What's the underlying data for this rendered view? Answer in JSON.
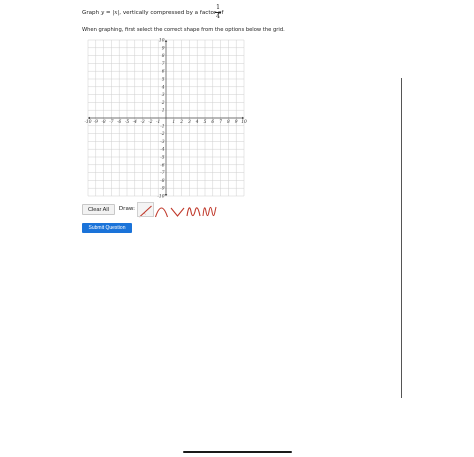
{
  "question": {
    "prefix": "Graph ",
    "equation": "y = |x|",
    "suffix": ", vertically compressed by a factor of ",
    "fraction": {
      "numerator": "1",
      "denominator": "4"
    }
  },
  "instructions": "When graphing, first select the correct shape from the options below the grid.",
  "grid": {
    "x_ticks": [
      "-10",
      "-9",
      "-8",
      "-7",
      "-6",
      "-5",
      "-4",
      "-3",
      "-2",
      "-1",
      "1",
      "2",
      "3",
      "4",
      "5",
      "6",
      "7",
      "8",
      "9",
      "10"
    ],
    "y_ticks": [
      "10",
      "9",
      "8",
      "7",
      "6",
      "5",
      "4",
      "3",
      "2",
      "1",
      "-1",
      "-2",
      "-3",
      "-4",
      "-5",
      "-6",
      "-7",
      "-8",
      "-9",
      "-10"
    ],
    "xlim": [
      -10,
      10
    ],
    "ylim": [
      -10,
      10
    ]
  },
  "toolbar": {
    "clear_label": "Clear All",
    "draw_label": "Draw:",
    "shapes": [
      {
        "icon": "line-shape-icon",
        "selected": true
      },
      {
        "icon": "parabola-shape-icon",
        "selected": false
      },
      {
        "icon": "absolute-value-shape-icon",
        "selected": false
      },
      {
        "icon": "cubic-wave-shape-icon",
        "selected": false
      },
      {
        "icon": "sine-wave-shape-icon",
        "selected": false
      }
    ]
  },
  "submit_label": "Submit Question",
  "colors": {
    "accent": "#1a73d9",
    "shape_stroke": "#c0392b",
    "grid_line": "#cfcfcf",
    "axis": "#444444"
  }
}
